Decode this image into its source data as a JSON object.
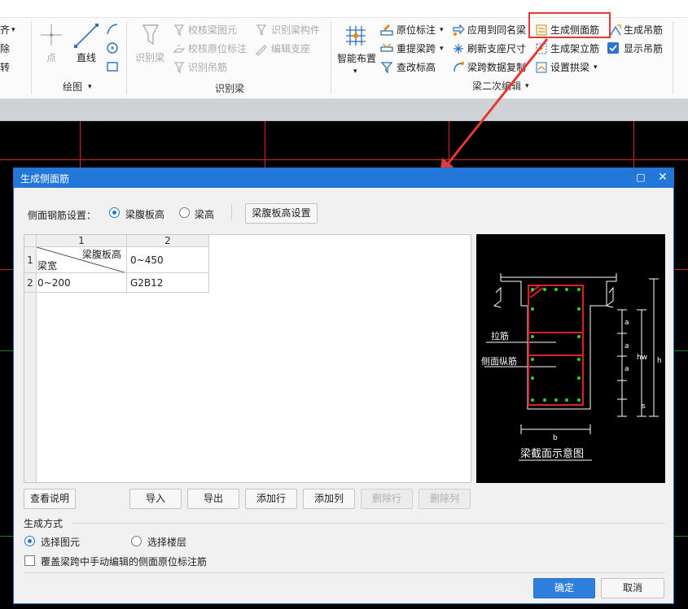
{
  "ribbon": {
    "partial_left": [
      "齐",
      "除",
      "转"
    ],
    "draw_group": {
      "point": "点",
      "line": "直线",
      "label": "绘图"
    },
    "identify_group": {
      "identify_beam": "识别梁",
      "check_beam_element": "校核梁图元",
      "check_in_situ_label": "校核原位标注",
      "identify_hanger": "识别吊筋",
      "identify_beam_member": "识别梁构件",
      "edit_support": "编辑支座",
      "label": "识别梁"
    },
    "secondary_edit_group": {
      "smart_layout": "智能布置",
      "in_situ_label": "原位标注",
      "reextract_span": "重提梁跨",
      "check_modify_label": "查改标高",
      "apply_same_name": "应用到同名梁",
      "refresh_support_size": "刷新支座尺寸",
      "copy_span_data": "梁跨数据复制",
      "generate_side_rebar": "生成侧面筋",
      "generate_erection_rebar": "生成架立筋",
      "set_arch_beam": "设置拱梁",
      "generate_hanger": "生成吊筋",
      "show_hanger": "显示吊筋",
      "label": "梁二次编辑"
    }
  },
  "dialog": {
    "title": "生成侧面筋",
    "setting_label": "侧面钢筋设置：",
    "radio_web_height": "梁腹板高",
    "radio_beam_height": "梁高",
    "web_height_setting_button": "梁腹板高设置",
    "table": {
      "col_numbers": [
        "1",
        "2"
      ],
      "row_numbers": [
        "1",
        "2"
      ],
      "corner_top": "梁腹板高",
      "corner_bottom": "梁宽",
      "header_value": "0~450",
      "row_label": "0~200",
      "row_value": "G2B12"
    },
    "preview": {
      "caption": "梁截面示意图",
      "tie_bar": "拉筋",
      "side_long_bar": "侧面纵筋",
      "dim_a": "a",
      "dim_s": "s",
      "dim_hw": "hw",
      "dim_h": "h",
      "dim_b": "b"
    },
    "buttons": {
      "view_help": "查看说明",
      "import": "导入",
      "export": "导出",
      "add_row": "添加行",
      "add_col": "添加列",
      "delete_row": "删除行",
      "delete_col": "删除列",
      "ok": "确定",
      "cancel": "取消"
    },
    "generate_mode": {
      "title": "生成方式",
      "select_element": "选择图元",
      "select_floor": "选择楼层",
      "override_label": "覆盖梁跨中手动编辑的侧面原位标注筋"
    }
  },
  "colors": {
    "accent": "#2277d9",
    "highlight": "#e53935",
    "rebar": "#e02020",
    "node": "#29d629"
  }
}
